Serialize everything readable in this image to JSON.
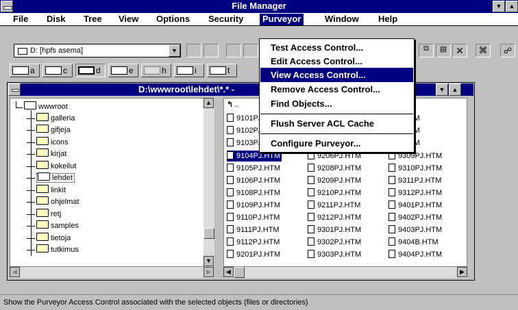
{
  "window": {
    "title": "File Manager"
  },
  "menubar": {
    "items": [
      {
        "label": "File"
      },
      {
        "label": "Disk"
      },
      {
        "label": "Tree"
      },
      {
        "label": "View"
      },
      {
        "label": "Options"
      },
      {
        "label": "Security"
      },
      {
        "label": "Purveyor"
      },
      {
        "label": "Window"
      },
      {
        "label": "Help"
      }
    ]
  },
  "toolbar": {
    "drive_value": "D: [hpfs asema]"
  },
  "drive_bar": {
    "drives": [
      {
        "letter": "a"
      },
      {
        "letter": "c"
      },
      {
        "letter": "d"
      },
      {
        "letter": "e"
      },
      {
        "letter": "h"
      },
      {
        "letter": "i"
      },
      {
        "letter": "t"
      }
    ]
  },
  "child": {
    "title": "D:\\wwwroot\\lehdet\\*.* -"
  },
  "tree": {
    "root": "wwwroot",
    "items": [
      "galleria",
      "gifjeja",
      "icons",
      "kirjat",
      "kokeilut",
      "lehdet",
      "linkit",
      "ohjelmat",
      "retj",
      "samples",
      "tietoja",
      "tutkimus"
    ],
    "selected": "lehdet"
  },
  "files": {
    "col1": [
      "..",
      "9101PJ.HTM",
      "9102PJ.HTM",
      "9103PJ.HTM",
      "9104PJ.HTM",
      "9105PJ.HTM",
      "9106PJ.HTM",
      "9108PJ.HTM",
      "9109PJ.HTM",
      "9110PJ.HTM",
      "9111PJ.HTM",
      "9112PJ.HTM",
      "9201PJ.HTM"
    ],
    "col2_visible": [
      "9206PJ.HTM",
      "9208PJ.HTM",
      "9209PJ.HTM",
      "9210PJ.HTM",
      "9211PJ.HTM",
      "9212PJ.HTM",
      "9301PJ.HTM",
      "9302PJ.HTM",
      "9303PJ.HTM"
    ],
    "col3": [
      "4PJ.HTM",
      "5PJ.HTM",
      "6PJ.HTM",
      "8PJ.HTM",
      "9309PJ.HTM",
      "9310PJ.HTM",
      "9311PJ.HTM",
      "9312PJ.HTM",
      "9401PJ.HTM",
      "9402PJ.HTM",
      "9403PJ.HTM",
      "9404B.HTM",
      "9404PJ.HTM"
    ],
    "selected": "9104PJ.HTM"
  },
  "purveyor_menu": {
    "items": [
      {
        "label": "Test Access Control..."
      },
      {
        "label": "Edit Access Control..."
      },
      {
        "label": "View Access Control..."
      },
      {
        "label": "Remove Access Control..."
      },
      {
        "label": "Find Objects..."
      },
      {
        "label": "Flush Server ACL Cache"
      },
      {
        "label": "Configure Purveyor..."
      }
    ],
    "highlighted": "View Access Control..."
  },
  "status": {
    "text": "Show the Purveyor Access Control associated with the selected objects (files or directories)"
  },
  "colors": {
    "titlebar": "#000080",
    "highlight": "#000080",
    "face": "#c0c0c0"
  }
}
